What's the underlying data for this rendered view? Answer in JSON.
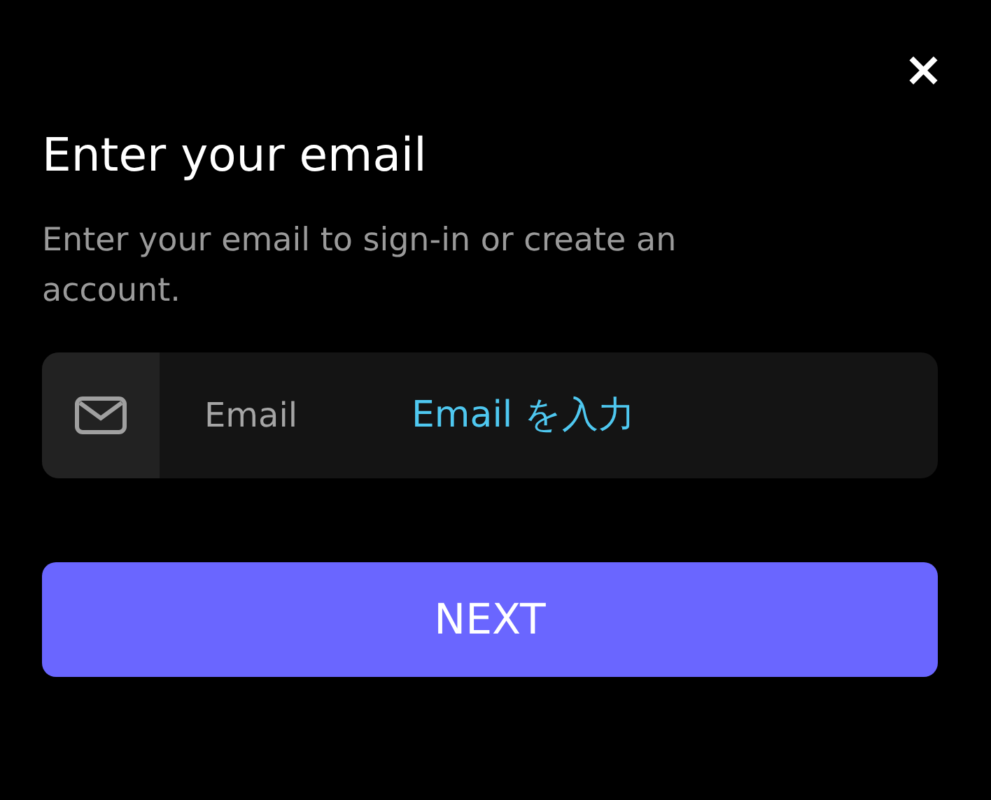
{
  "dialog": {
    "close": "×",
    "title": "Enter your email",
    "description": "Enter your email to sign-in or create an account."
  },
  "email_field": {
    "label": "Email",
    "placeholder": "Email を入力"
  },
  "buttons": [
    "NEXT"
  ]
}
